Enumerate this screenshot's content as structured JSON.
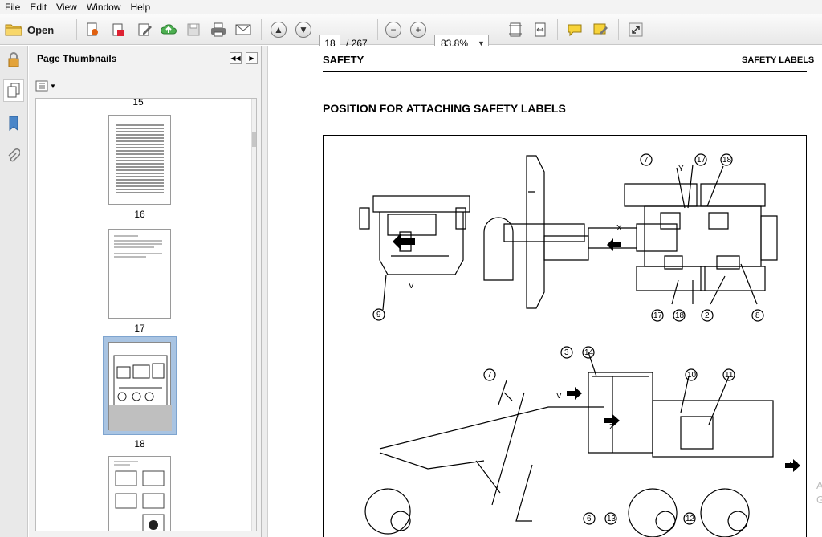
{
  "menu": [
    "File",
    "Edit",
    "View",
    "Window",
    "Help"
  ],
  "toolbar": {
    "open_label": "Open",
    "page_current": "18",
    "page_total": "/ 267",
    "zoom": "83.8%"
  },
  "panel": {
    "title": "Page Thumbnails",
    "thumbnails": [
      {
        "label": "15",
        "selected": false
      },
      {
        "label": "16",
        "selected": false
      },
      {
        "label": "17",
        "selected": false
      },
      {
        "label": "18",
        "selected": true
      }
    ]
  },
  "document": {
    "header_left": "SAFETY",
    "header_right": "SAFETY LABELS",
    "section_title": "POSITION FOR ATTACHING SAFETY LABELS",
    "callouts": {
      "top_left_view": [
        "V",
        "9"
      ],
      "top_plan_view": [
        "7",
        "17",
        "18",
        "Y",
        "X",
        "17",
        "18",
        "2",
        "8"
      ],
      "side_view": [
        "3",
        "14",
        "7",
        "10",
        "11",
        "V",
        "Z",
        "W",
        "6",
        "13",
        "12"
      ]
    }
  },
  "watermark": [
    "A",
    "G"
  ],
  "colors": {
    "selected_thumbnail": "#a9c4e2",
    "menubar": "#f3f3f3",
    "panel": "#f2f2f2"
  }
}
